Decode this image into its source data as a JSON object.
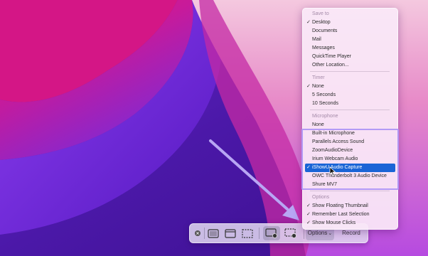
{
  "menu": {
    "sections": [
      {
        "header": "Save to",
        "items": [
          {
            "label": "Desktop",
            "checked": true
          },
          {
            "label": "Documents",
            "checked": false
          },
          {
            "label": "Mail",
            "checked": false
          },
          {
            "label": "Messages",
            "checked": false
          },
          {
            "label": "QuickTime Player",
            "checked": false
          },
          {
            "label": "Other Location...",
            "checked": false
          }
        ]
      },
      {
        "header": "Timer",
        "items": [
          {
            "label": "None",
            "checked": true
          },
          {
            "label": "5 Seconds",
            "checked": false
          },
          {
            "label": "10 Seconds",
            "checked": false
          }
        ]
      },
      {
        "header": "Microphone",
        "items": [
          {
            "label": "None",
            "checked": false
          },
          {
            "label": "Built-in Microphone",
            "checked": false
          },
          {
            "label": "Parallels Access Sound",
            "checked": false
          },
          {
            "label": "ZoomAudioDevice",
            "checked": false
          },
          {
            "label": "Irium Webcam Audio",
            "checked": false
          },
          {
            "label": "iShowU Audio Capture",
            "checked": true,
            "selected": true
          },
          {
            "label": "OWC Thunderbolt 3 Audio Device",
            "checked": false
          },
          {
            "label": "Shure MV7",
            "checked": false
          }
        ]
      },
      {
        "header": "Options",
        "items": [
          {
            "label": "Show Floating Thumbnail",
            "checked": true
          },
          {
            "label": "Remember Last Selection",
            "checked": true
          },
          {
            "label": "Show Mouse Clicks",
            "checked": true
          }
        ]
      }
    ]
  },
  "toolbar": {
    "options_label": "Options",
    "record_label": "Record",
    "close_icon": "close-icon",
    "tools": [
      {
        "name": "capture-entire-screen",
        "icon": "screen-icon"
      },
      {
        "name": "capture-window",
        "icon": "window-icon"
      },
      {
        "name": "capture-selection",
        "icon": "selection-icon"
      },
      {
        "name": "record-entire-screen",
        "icon": "record-screen-icon",
        "active": true
      },
      {
        "name": "record-selection",
        "icon": "record-selection-icon"
      }
    ]
  },
  "colors": {
    "selection": "#1a64d6",
    "highlight_border": "#af96f5",
    "arrow": "#b8a6f4"
  }
}
